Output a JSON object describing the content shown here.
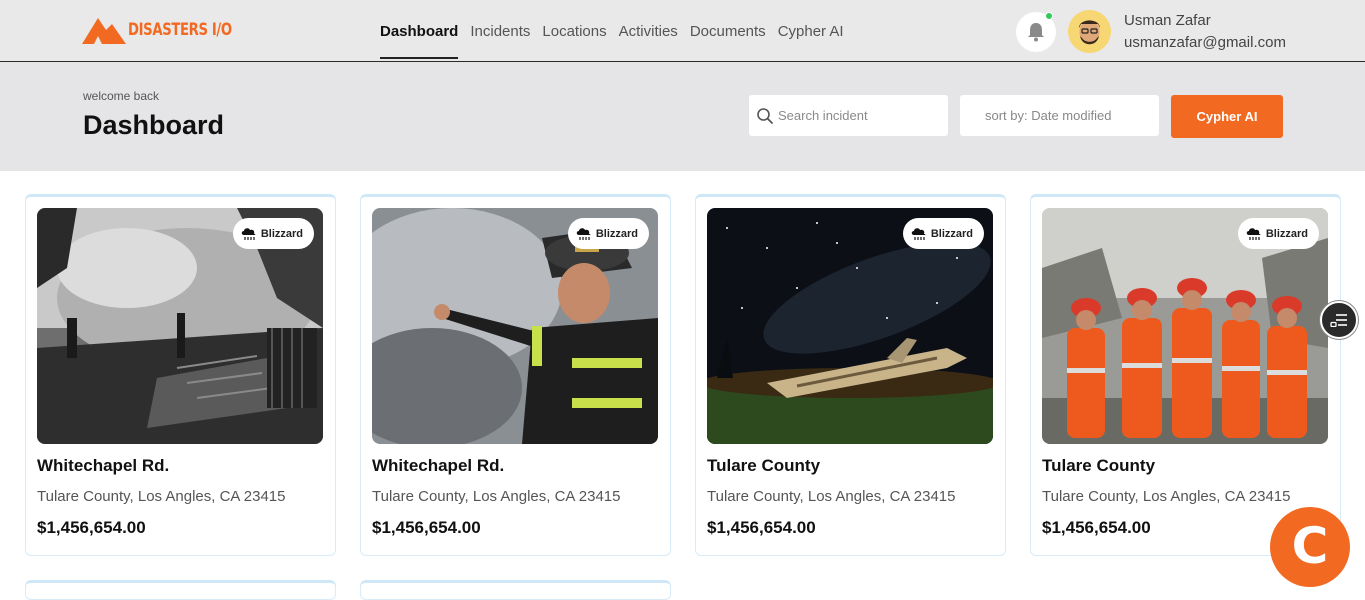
{
  "brand": {
    "logo_text": "DISASTERS I/O",
    "accent": "#f26a21"
  },
  "nav": {
    "items": [
      {
        "label": "Dashboard",
        "active": true
      },
      {
        "label": "Incidents",
        "active": false
      },
      {
        "label": "Locations",
        "active": false
      },
      {
        "label": "Activities",
        "active": false
      },
      {
        "label": "Documents",
        "active": false
      },
      {
        "label": "Cypher AI",
        "active": false
      }
    ]
  },
  "user": {
    "name": "Usman Zafar",
    "email": "usmanzafar@gmail.com",
    "notification_status": "online-green"
  },
  "header": {
    "welcome": "welcome back",
    "title": "Dashboard",
    "search_placeholder": "Search incident",
    "sort_label": "sort by: Date modified",
    "cta_label": "Cypher AI"
  },
  "cards": [
    {
      "badge": "Blizzard",
      "title": "Whitechapel Rd.",
      "address": "Tulare County, Los Angles, CA 23415",
      "price": "$1,456,654.00",
      "image": "burned-debris-firefighters"
    },
    {
      "badge": "Blizzard",
      "title": "Whitechapel Rd.",
      "address": "Tulare County, Los Angles, CA 23415",
      "price": "$1,456,654.00",
      "image": "firefighter-pointing"
    },
    {
      "badge": "Blizzard",
      "title": "Tulare County",
      "address": "Tulare County, Los Angles, CA 23415",
      "price": "$1,456,654.00",
      "image": "plane-wreck-night-sky"
    },
    {
      "badge": "Blizzard",
      "title": "Tulare County",
      "address": "Tulare County, Los Angles, CA 23415",
      "price": "$1,456,654.00",
      "image": "rescue-team-orange"
    }
  ],
  "fabs": {
    "filter_icon": "filter-list-icon",
    "brand_letter": "C"
  }
}
